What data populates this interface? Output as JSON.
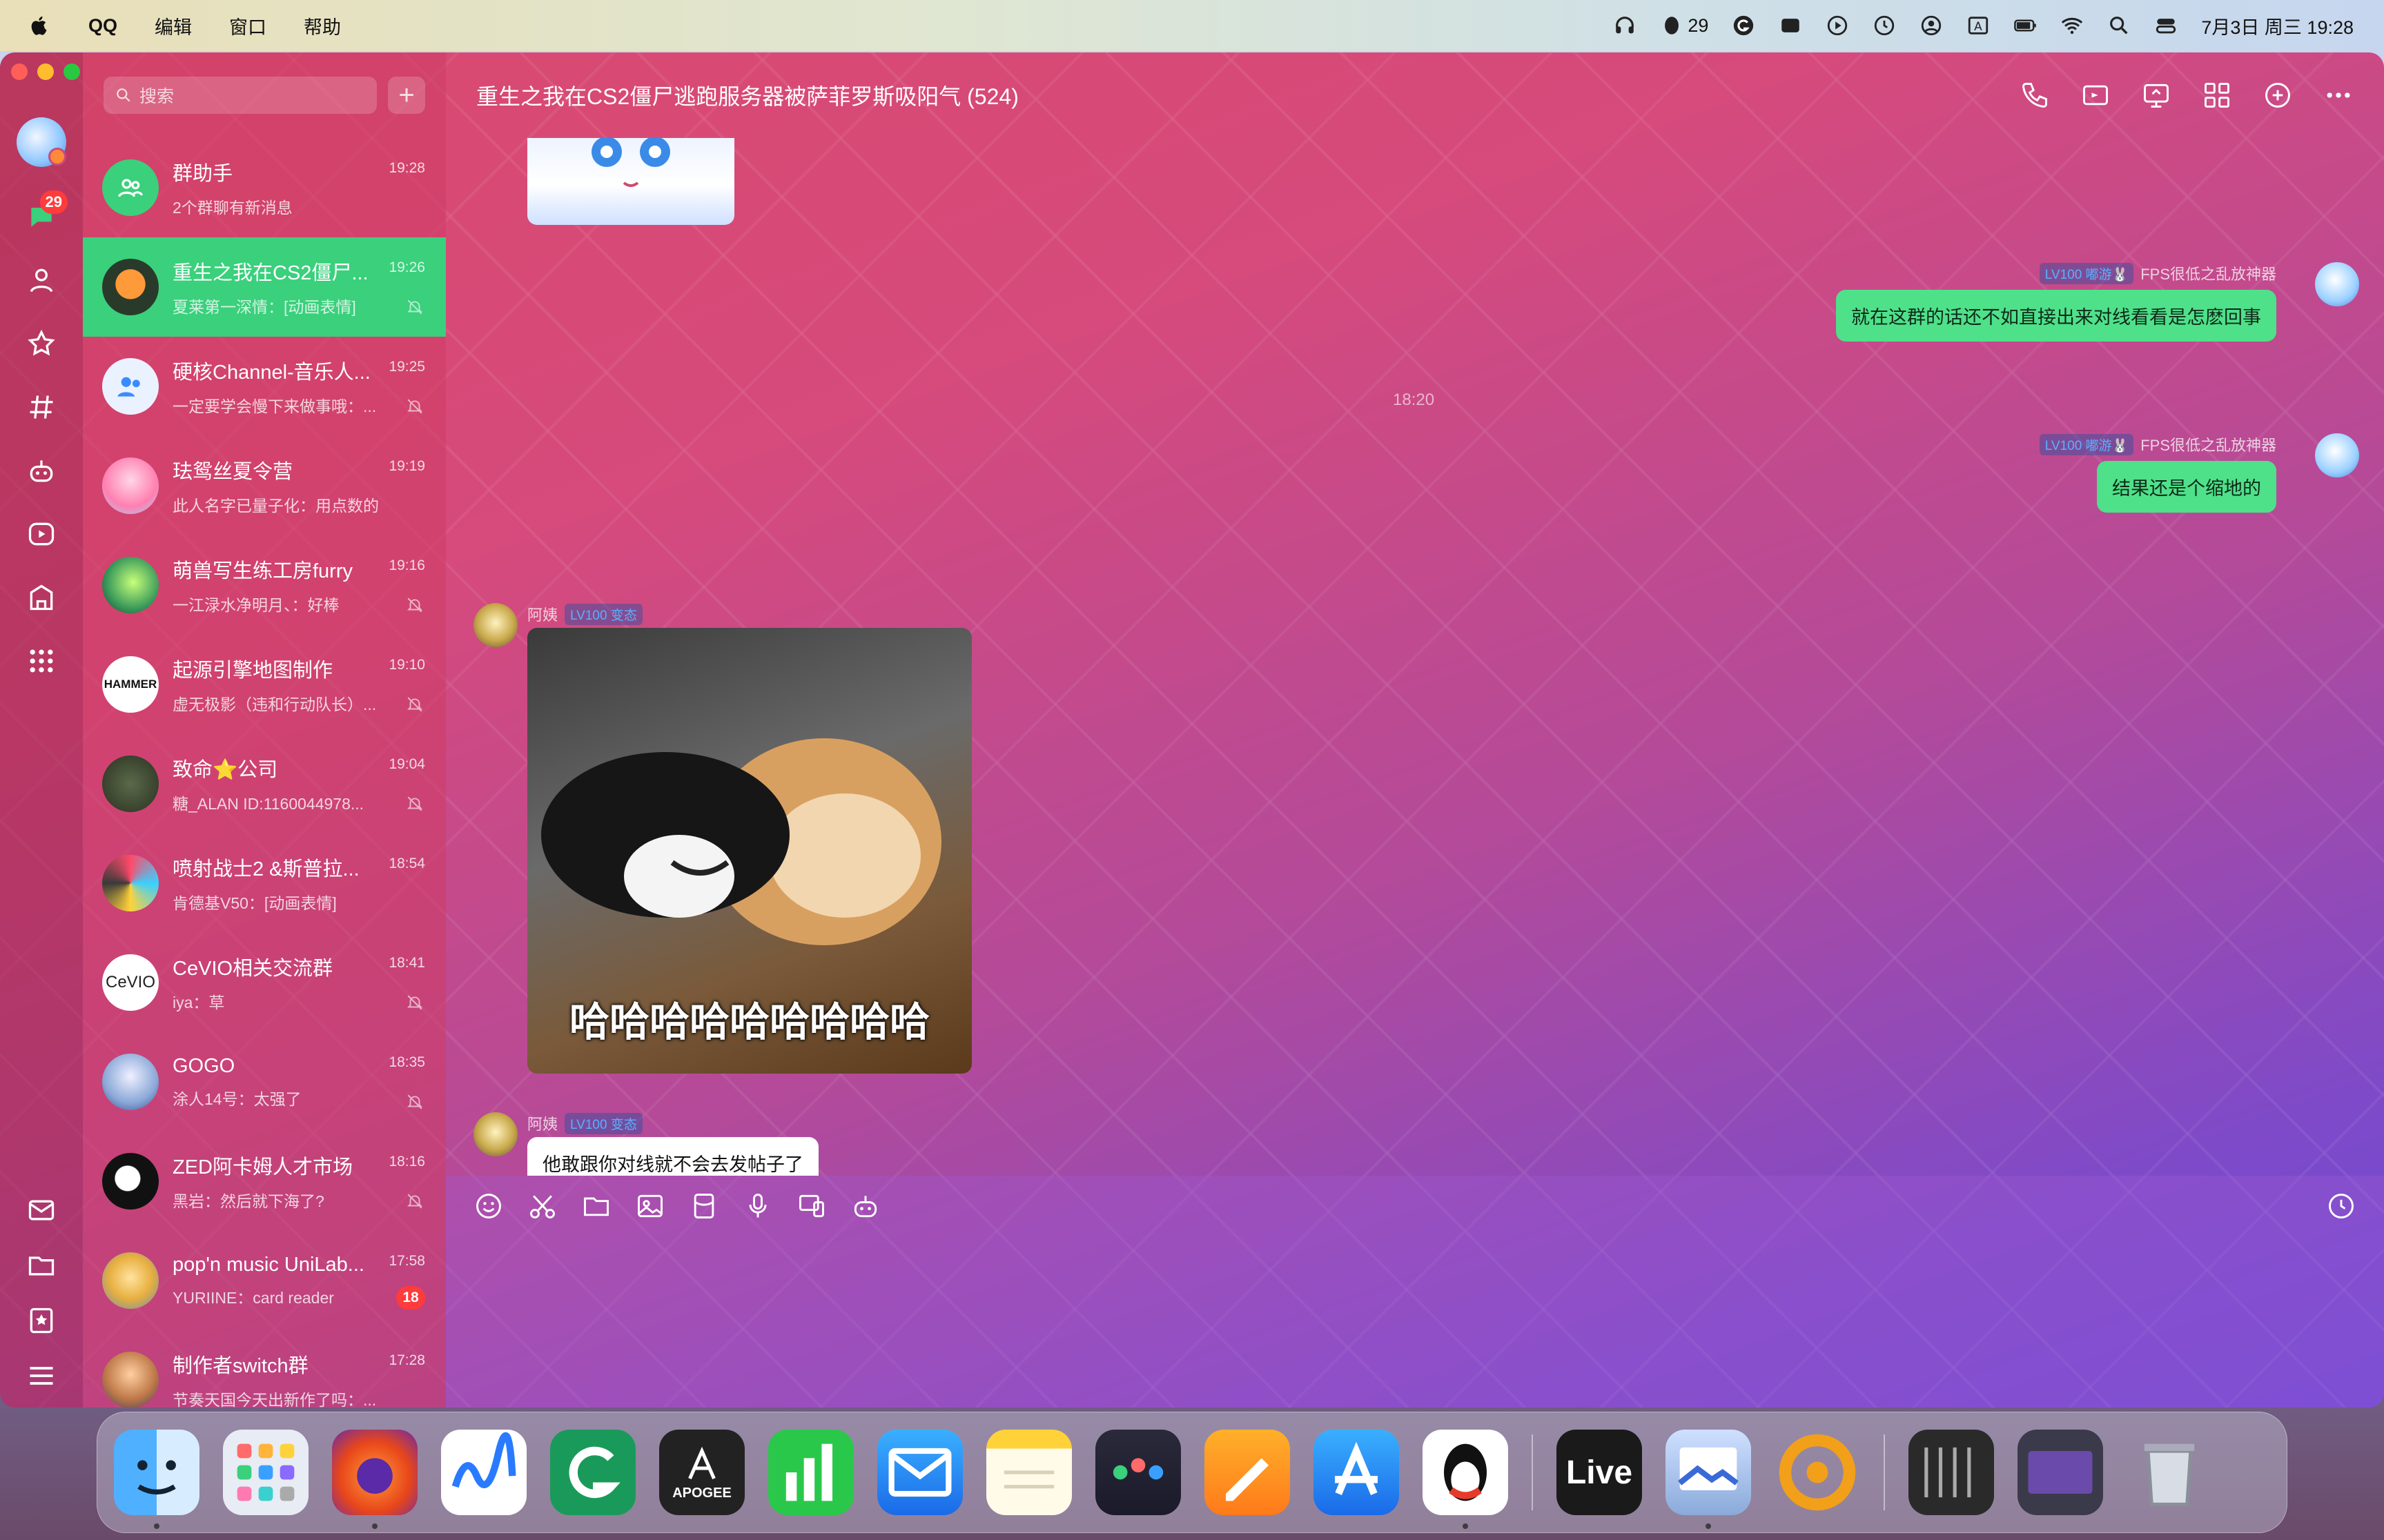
{
  "menubar": {
    "app_name": "QQ",
    "menus": [
      "编辑",
      "窗口",
      "帮助"
    ],
    "qq_badge_count": "29",
    "datetime": "7月3日 周三  19:28"
  },
  "sidebar": {
    "badge_count": "29"
  },
  "search": {
    "placeholder": "搜索"
  },
  "conversations": [
    {
      "title": "群助手",
      "message": "2个群聊有新消息",
      "time": "19:28"
    },
    {
      "title": "重生之我在CS2僵尸...",
      "message": "夏莱第一深情：[动画表情]",
      "time": "19:26"
    },
    {
      "title": "硬核Channel-音乐人...",
      "message": "一定要学会慢下来做事哦：...",
      "time": "19:25"
    },
    {
      "title": "珐鸳丝夏令营",
      "message": "此人名字已量子化：用点数的",
      "time": "19:19"
    },
    {
      "title": "萌兽写生练工房furry",
      "message": "一江渌水净明月、：好棒",
      "time": "19:16"
    },
    {
      "title": "起源引擎地图制作",
      "message": "虚无极影（违和行动队长）...",
      "time": "19:10"
    },
    {
      "title": "致命⭐️公司",
      "message": "糖_ALAN ID:1160044978...",
      "time": "19:04"
    },
    {
      "title": "喷射战士2 &斯普拉...",
      "message": "肯德基V50：[动画表情]",
      "time": "18:54"
    },
    {
      "title": "CeVIO相关交流群",
      "message": "iya：草",
      "time": "18:41"
    },
    {
      "title": "GOGO",
      "message": "涂人14号：太强了",
      "time": "18:35"
    },
    {
      "title": "ZED阿卡姆人才市场",
      "message": "黑岩：然后就下海了?",
      "time": "18:16"
    },
    {
      "title": "pop'n music UniLab...",
      "message": "YURIINE：card reader",
      "time": "17:58",
      "unread": "18"
    },
    {
      "title": "制作者switch群",
      "message": "节奏天国今天出新作了吗：...",
      "time": "17:28"
    }
  ],
  "chat": {
    "title": "重生之我在CS2僵尸逃跑服务器被萨菲罗斯吸阳气 (524)",
    "messages": {
      "m1": {
        "level": "LV100 嘟游🐰",
        "name": "FPS很低之乱放神器",
        "text": "就在这群的话还不如直接出来对线看看是怎麽回事"
      },
      "timestamp": "18:20",
      "m2": {
        "level": "LV100 嘟游🐰",
        "name": "FPS很低之乱放神器",
        "text": "结果还是个缩地的"
      },
      "m3": {
        "name": "阿姨",
        "level": "LV100 变态",
        "sticker_caption": "哈哈哈哈哈哈哈哈哈"
      },
      "m4": {
        "name": "阿姨",
        "level": "LV100 变态",
        "text": "他敢跟你对线就不会去发帖子了"
      }
    }
  },
  "dock": {
    "live_label": "Live",
    "apogee_label": "APOGEE"
  },
  "colors": {
    "accent_green": "#3ad07c",
    "bubble_green": "#4fe08a",
    "badge_red": "#ff3b3b"
  }
}
